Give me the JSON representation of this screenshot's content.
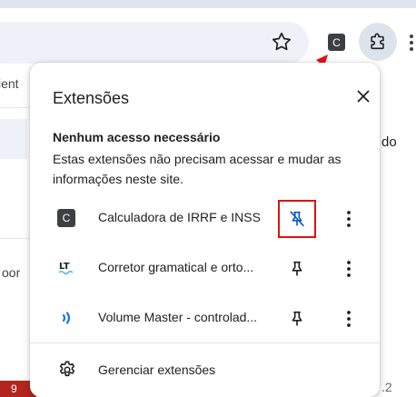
{
  "background": {
    "left_fragments": [
      "ient",
      "oor"
    ],
    "right_fragments": [
      "do",
      ".2"
    ],
    "bottom_badge": "9"
  },
  "toolbar": {
    "extension_badge": "C",
    "star_icon": "star-outline-icon",
    "extensions_icon": "puzzle-icon"
  },
  "popup": {
    "title": "Extensões",
    "section_heading": "Nenhum acesso necessário",
    "section_description": "Estas extensões não precisam acessar e mudar as informações neste site.",
    "extensions": [
      {
        "name": "Calculadora de IRRF e INSS",
        "icon": "C",
        "pinned": true
      },
      {
        "name": "Corretor gramatical e orto...",
        "icon": "LT",
        "pinned": false
      },
      {
        "name": "Volume Master - controlad...",
        "icon": "volume-icon",
        "pinned": false
      }
    ],
    "manage_label": "Gerenciar extensões"
  },
  "colors": {
    "accent_blue": "#0b57d0",
    "highlight_red": "#e01010",
    "lt_blue": "#1a73e8",
    "lt_wave": "#5bc0eb"
  }
}
